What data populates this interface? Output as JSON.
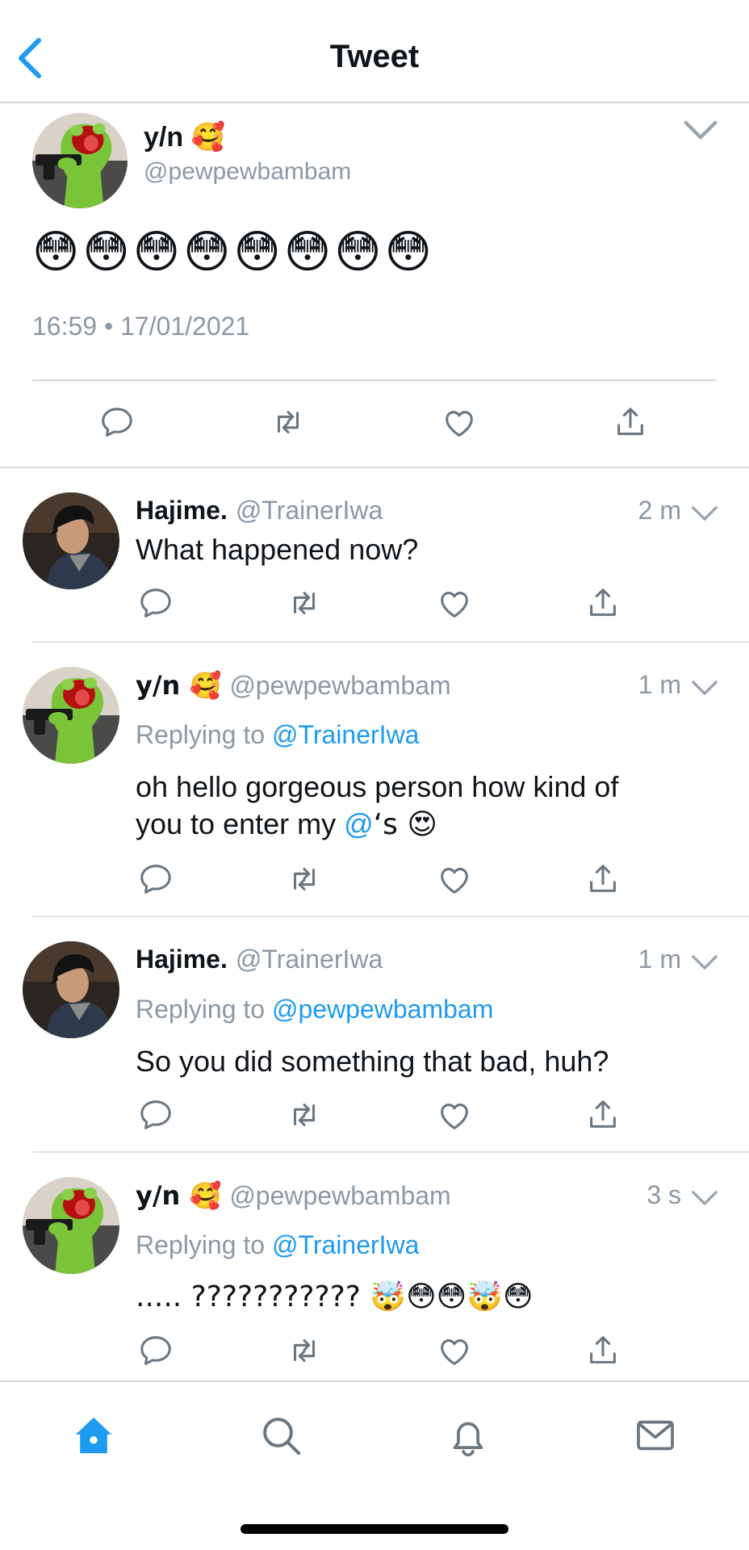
{
  "header": {
    "title": "Tweet"
  },
  "main_tweet": {
    "author": "y/n 🥰",
    "handle": "@pewpewbambam",
    "text": "😳😳😳😳😳😳😳😳",
    "timestamp": "16:59 • 17/01/2021"
  },
  "replies": [
    {
      "name": "Hajime.",
      "handle": "@TrainerIwa",
      "time": "2 m",
      "replying_label": "",
      "replying_to": "",
      "text": "What happened now?"
    },
    {
      "name": "y/n 🥰",
      "handle": "@pewpewbambam",
      "time": "1 m",
      "replying_label": "Replying to",
      "replying_to": "@TrainerIwa",
      "text_line1": "oh hello gorgeous person how kind of",
      "text_line2_a": "you to enter my ",
      "text_line2_link": "@",
      "text_line2_b": "‘s 😍"
    },
    {
      "name": "Hajime.",
      "handle": "@TrainerIwa",
      "time": "1 m",
      "replying_label": "Replying to",
      "replying_to": "@pewpewbambam",
      "text": "So you did something that bad, huh?"
    },
    {
      "name": "y/n 🥰",
      "handle": "@pewpewbambam",
      "time": "3 s",
      "replying_label": "Replying to",
      "replying_to": "@TrainerIwa",
      "text": "..... ??????????? 🤯😳😳🤯😳"
    }
  ],
  "colors": {
    "accent": "#1d9bf0",
    "muted": "#8b98a5",
    "divider": "#d7dadd"
  },
  "icons": [
    "back-chevron-icon",
    "chevron-down-icon",
    "reply-icon",
    "retweet-icon",
    "like-icon",
    "share-icon",
    "home-icon",
    "search-icon",
    "notifications-icon",
    "messages-icon"
  ]
}
